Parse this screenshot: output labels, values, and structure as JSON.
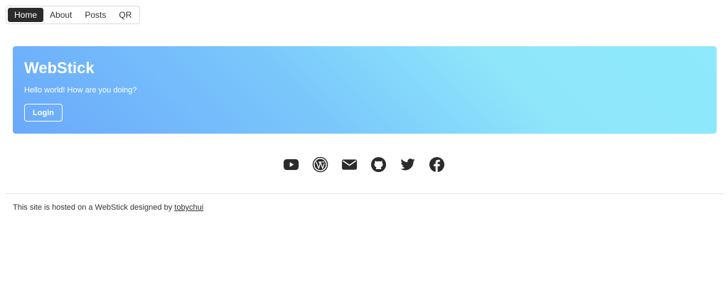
{
  "nav": {
    "items": [
      {
        "label": "Home"
      },
      {
        "label": "About"
      },
      {
        "label": "Posts"
      },
      {
        "label": "QR"
      }
    ],
    "active": "Home"
  },
  "hero": {
    "title": "WebStick",
    "subtitle": "Hello world! How are you doing?",
    "login_label": "Login",
    "gradient_colors": [
      "#6aa9fb",
      "#8ee9fc"
    ]
  },
  "social_icons": [
    "youtube-icon",
    "wordpress-icon",
    "email-icon",
    "github-icon",
    "twitter-icon",
    "facebook-icon"
  ],
  "footer": {
    "text": "This site is hosted on a WebStick designed by ",
    "link_label": "tobychui"
  },
  "colors": {
    "nav_active_bg": "#2b2b2b",
    "icon_color": "#2b2b2b",
    "text": "#333333"
  }
}
